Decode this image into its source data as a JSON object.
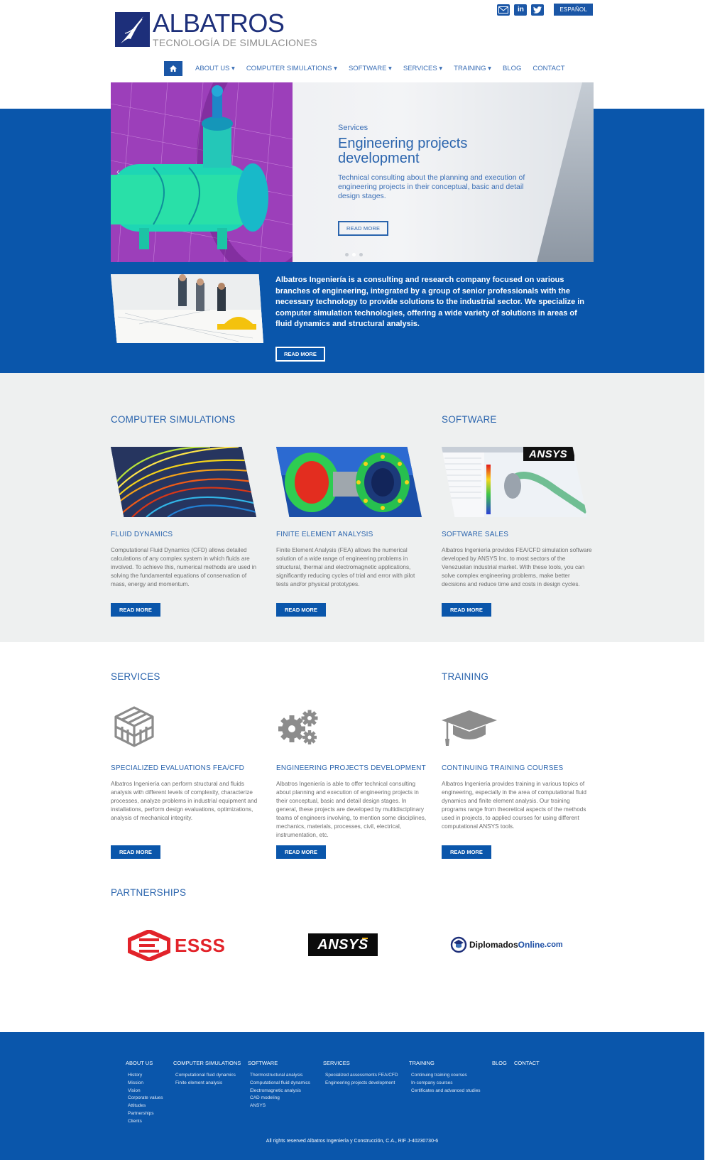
{
  "brand": {
    "name": "ALBATROS",
    "tagline": "TECNOLOGÍA DE SIMULACIONES"
  },
  "topbar": {
    "icons": [
      "email-icon",
      "linkedin-icon",
      "twitter-icon"
    ],
    "language_button": "ESPAÑOL"
  },
  "nav": {
    "items": [
      {
        "label": "ABOUT US",
        "dropdown": true
      },
      {
        "label": "COMPUTER SIMULATIONS",
        "dropdown": true
      },
      {
        "label": "SOFTWARE",
        "dropdown": true
      },
      {
        "label": "SERVICES",
        "dropdown": true
      },
      {
        "label": "TRAINING",
        "dropdown": true
      },
      {
        "label": "BLOG",
        "dropdown": false
      },
      {
        "label": "CONTACT",
        "dropdown": false
      }
    ]
  },
  "hero": {
    "eyebrow": "Services",
    "title": "Engineering projects development",
    "description": "Technical consulting about the planning and execution of engineering projects in their conceptual, basic and detail design stages.",
    "button": "READ MORE"
  },
  "intro": {
    "text": "Albatros Ingeniería is a consulting and research company focused on various branches of engineering, integrated by a group of senior professionals with the necessary technology to provide solutions to the industrial sector. We specialize in computer simulation technologies, offering a wide variety of solutions in areas of fluid dynamics and structural analysis.",
    "button": "READ MORE"
  },
  "sections": {
    "computer_simulations": "COMPUTER SIMULATIONS",
    "software": "SOFTWARE",
    "services": "SERVICES",
    "training": "TRAINING",
    "partnerships": "PARTNERSHIPS"
  },
  "cards_row1": [
    {
      "title": "FLUID DYNAMICS",
      "text": "Computational Fluid Dynamics (CFD) allows detailed calculations of any complex system in which fluids are involved. To achieve this, numerical methods are used in solving the fundamental equations of conservation of mass, energy and momentum.",
      "button": "READ MORE"
    },
    {
      "title": "FINITE ELEMENT ANALYSIS",
      "text": "Finite Element Analysis (FEA) allows the numerical solution of a wide range of engineering problems in structural, thermal and electromagnetic applications, significantly reducing cycles of trial and error with pilot tests and/or physical prototypes.",
      "button": "READ MORE"
    },
    {
      "title": "SOFTWARE SALES",
      "text": "Albatros Ingeniería provides FEA/CFD simulation software developed by ANSYS Inc. to most sectors of the Venezuelan industrial market. With these tools, you can solve complex engineering problems, make better decisions and reduce time and costs in design cycles.",
      "button": "READ MORE",
      "logo": "ANSYS"
    }
  ],
  "cards_row2": [
    {
      "title": "SPECIALIZED EVALUATIONS FEA/CFD",
      "text": "Albatros Ingeniería can perform structural and fluids analysis with different levels of complexity, characterize processes, analyze problems in industrial equipment and installations, perform design evaluations, optimizations, analysis of mechanical integrity.",
      "button": "READ MORE",
      "icon": "cube-grid-icon"
    },
    {
      "title": "ENGINEERING PROJECTS DEVELOPMENT",
      "text": "Albatros Ingeniería is able to offer technical consulting about planning and execution of engineering projects in their conceptual, basic and detail design stages. In general, these projects are developed by multidisciplinary teams of engineers involving, to mention some disciplines, mechanics, materials, processes, civil, electrical, instrumentation, etc.",
      "button": "READ MORE",
      "icon": "gears-icon"
    },
    {
      "title": "CONTINUING TRAINING COURSES",
      "text": "Albatros Ingeniería provides training in various topics of engineering, especially in the area of computational fluid dynamics and finite element analysis. Our training programs range from theoretical aspects of the methods used in projects, to applied courses for using different computational ANSYS tools.",
      "button": "READ MORE",
      "icon": "graduation-cap-icon"
    }
  ],
  "partners": {
    "esss": "ESSS",
    "ansys": "ANSYS",
    "diplomados_a": "Diplomados",
    "diplomados_b": "Online",
    "diplomados_c": ".com"
  },
  "colors": {
    "primary": "#0a56ab",
    "navy": "#1d2f7a",
    "accent_text": "#2a64ad",
    "gray_bg": "#eef0f0",
    "esss_red": "#e2232a"
  },
  "footer": {
    "columns": [
      {
        "head": "ABOUT US",
        "links": [
          "History",
          "Mission",
          "Vision",
          "Corporate values",
          "Attitudes",
          "Partnerships",
          "Clients"
        ]
      },
      {
        "head": "COMPUTER SIMULATIONS",
        "links": [
          "Computational fluid dynamics",
          "Finite element analysis"
        ]
      },
      {
        "head": "SOFTWARE",
        "links": [
          "Thermostructural analysis",
          "Computational fluid dynamics",
          "Electromagnetic analysis",
          "CAD modeling",
          "ANSYS"
        ]
      },
      {
        "head": "SERVICES",
        "links": [
          "Specialized assessments FEA/CFD",
          "Engineering projects development"
        ]
      },
      {
        "head": "TRAINING",
        "links": [
          "Continuing training courses",
          "In-company courses",
          "Certificates and advanced studies"
        ]
      },
      {
        "head": "BLOG",
        "links": []
      },
      {
        "head": "CONTACT",
        "links": []
      }
    ],
    "copyright": "All rights reserved Albatros Ingeniería y Construcción, C.A., RIF J-40230730-6"
  }
}
